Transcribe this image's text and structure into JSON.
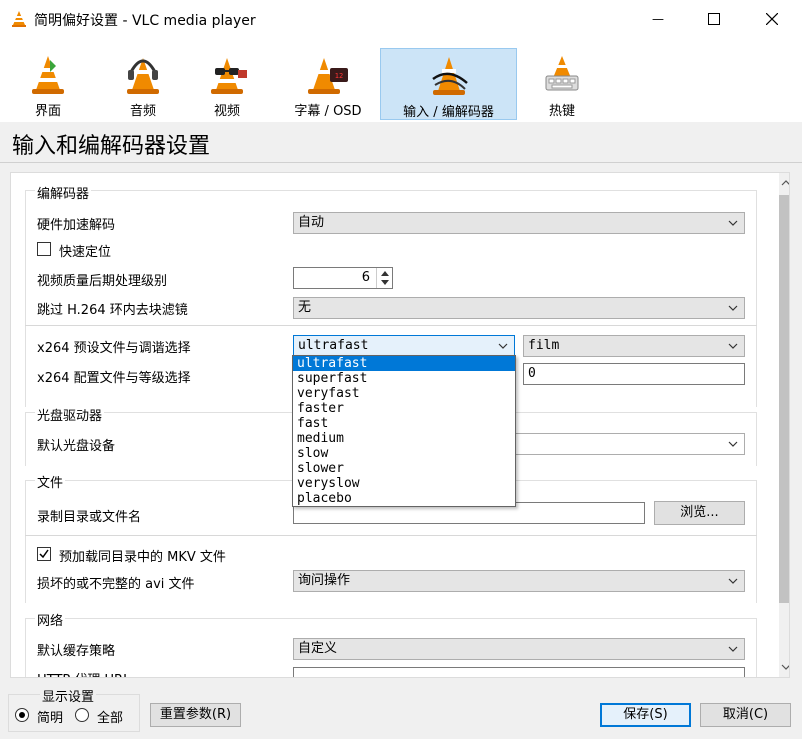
{
  "window": {
    "title": "简明偏好设置 - VLC media player",
    "minimize_glyph": "—",
    "colors": {
      "accent": "#0078d7",
      "selected_tab_bg": "#cce4f7"
    }
  },
  "categories": [
    {
      "label": "界面",
      "icon": "vlc-cone-icon"
    },
    {
      "label": "音频",
      "icon": "headphones-cone-icon"
    },
    {
      "label": "视频",
      "icon": "glasses-cone-icon"
    },
    {
      "label": "字幕 / OSD",
      "icon": "clock-cone-icon"
    },
    {
      "label": "输入 / 编解码器",
      "icon": "cables-cone-icon",
      "selected": true
    },
    {
      "label": "热键",
      "icon": "keyboard-cone-icon"
    }
  ],
  "page_title": "输入和编解码器设置",
  "codecs": {
    "title": "编解码器",
    "hw_decoding_label": "硬件加速解码",
    "hw_decoding_value": "自动",
    "fast_seek_label": "快速定位",
    "fast_seek_checked": false,
    "postproc_label": "视频质量后期处理级别",
    "postproc_value": "6",
    "skip_h264_label": "跳过 H.264 环内去块滤镜",
    "skip_h264_value": "无",
    "x264_preset_label": "x264 预设文件与调谐选择",
    "x264_preset_value": "ultrafast",
    "x264_tune_value": "film",
    "x264_profile_label": "x264 配置文件与等级选择",
    "x264_level_value": "0"
  },
  "preset_options": [
    "ultrafast",
    "superfast",
    "veryfast",
    "faster",
    "fast",
    "medium",
    "slow",
    "slower",
    "veryslow",
    "placebo"
  ],
  "disc": {
    "title": "光盘驱动器",
    "default_device_label": "默认光盘设备",
    "default_device_value": ""
  },
  "files": {
    "title": "文件",
    "record_label": "录制目录或文件名",
    "record_value": "",
    "browse_label": "浏览...",
    "preload_mkv_label": "预加载同目录中的 MKV 文件",
    "preload_mkv_checked": true,
    "broken_avi_label": "损坏的或不完整的 avi 文件",
    "broken_avi_value": "询问操作"
  },
  "network": {
    "title": "网络",
    "caching_label": "默认缓存策略",
    "caching_value": "自定义",
    "http_proxy_label": "HTTP 代理 URL"
  },
  "footer": {
    "display_title": "显示设置",
    "simple_label": "简明",
    "all_label": "全部",
    "simple_selected": true,
    "reset_label": "重置参数(R)",
    "save_label": "保存(S)",
    "cancel_label": "取消(C)"
  }
}
